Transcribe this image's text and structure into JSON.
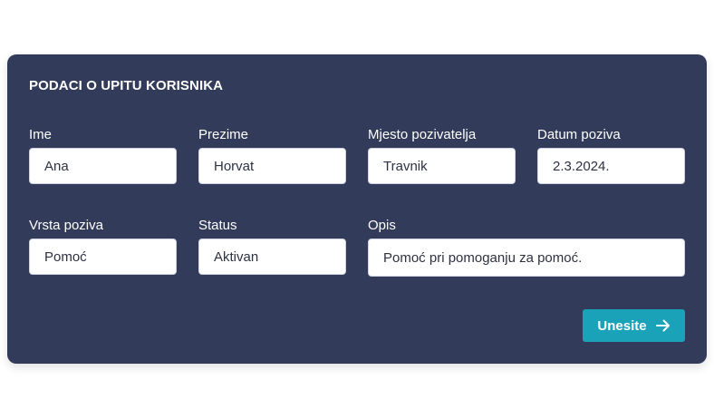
{
  "form": {
    "title": "PODACI O UPITU KORISNIKA",
    "fields": {
      "ime": {
        "label": "Ime",
        "value": "Ana"
      },
      "prezime": {
        "label": "Prezime",
        "value": "Horvat"
      },
      "mjesto": {
        "label": "Mjesto pozivatelja",
        "value": "Travnik"
      },
      "datum": {
        "label": "Datum poziva",
        "value": "2.3.2024."
      },
      "vrsta": {
        "label": "Vrsta poziva",
        "value": "Pomoć"
      },
      "status": {
        "label": "Status",
        "value": "Aktivan"
      },
      "opis": {
        "label": "Opis",
        "value": "Pomoć pri pomoganju za pomoć."
      }
    },
    "submit_label": "Unesite",
    "submit_icon": "arrow-right-icon",
    "colors": {
      "card_background": "#323b5a",
      "button_background": "#1aa3b8"
    }
  }
}
